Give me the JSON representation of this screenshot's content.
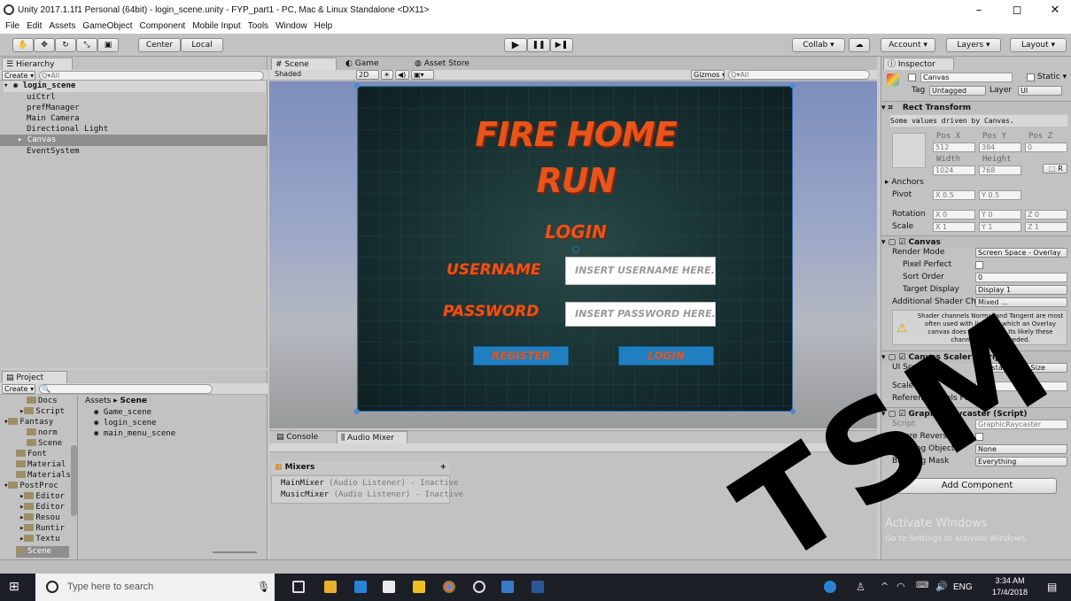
{
  "window": {
    "title": "Unity 2017.1.1f1 Personal (64bit) - login_scene.unity - FYP_part1 - PC, Mac & Linux Standalone <DX11>",
    "minimize": "–",
    "maximize": "◻",
    "close": "✕"
  },
  "menu": [
    "File",
    "Edit",
    "Assets",
    "GameObject",
    "Component",
    "Mobile Input",
    "Tools",
    "Window",
    "Help"
  ],
  "toolbar": {
    "center_label": "Center",
    "local_label": "Local",
    "collab_label": "Collab ▾",
    "account_label": "Account ▾",
    "layers_label": "Layers ▾",
    "layout_label": "Layout ▾",
    "play": "▶",
    "pause": "❚❚",
    "step": "▶❚"
  },
  "hierarchy": {
    "tab": "Hierarchy",
    "create": "Create ▾",
    "search": "Q▾All",
    "scene": "login_scene",
    "items": [
      "uiCtrl",
      "prefManager",
      "Main Camera",
      "Directional Light",
      "Canvas",
      "EventSystem"
    ]
  },
  "scene_view": {
    "tabs": [
      "Scene",
      "Game",
      "Asset Store"
    ],
    "shading": "Shaded",
    "mode_2d": "2D",
    "gizmos": "Gizmos ▾",
    "search": "Q▾All"
  },
  "game_ui": {
    "title_line1": "FIRE HOME",
    "title_line2": "RUN",
    "login_heading": "LOGIN",
    "username_label": "USERNAME",
    "password_label": "PASSWORD",
    "username_placeholder": "INSERT USERNAME HERE...",
    "password_placeholder": "INSERT PASSWORD HERE...",
    "register_button": "REGISTER",
    "login_button": "LOGIN"
  },
  "project": {
    "tab": "Project",
    "create": "Create ▾",
    "breadcrumb_root": "Assets",
    "breadcrumb_leaf": "Scene",
    "folders": [
      "Docs",
      "Script",
      "Fantasy",
      "norm",
      "Scene",
      "Font",
      "Material",
      "Materials",
      "PostProc",
      "Editor",
      "Editor",
      "Resou",
      "Runtir",
      "Textu",
      "Scene"
    ],
    "files": [
      "Game_scene",
      "login_scene",
      "main_menu_scene"
    ]
  },
  "console": {
    "tabs": [
      "Console",
      "Audio Mixer"
    ],
    "mixers_header": "Mixers",
    "mixers": [
      {
        "name": "MainMixer",
        "status": "(Audio Listener) - Inactive"
      },
      {
        "name": "MusicMixer",
        "status": "(Audio Listener) - Inactive"
      }
    ]
  },
  "inspector": {
    "tab": "Inspector",
    "object_name": "Canvas",
    "static_label": "Static ▾",
    "tag_label": "Tag",
    "tag_value": "Untagged",
    "layer_label": "Layer",
    "layer_value": "UI",
    "rect_transform": {
      "title": "Rect Transform",
      "note": "Some values driven by Canvas.",
      "pos_x_label": "Pos X",
      "pos_y_label": "Pos Y",
      "pos_z_label": "Pos Z",
      "pos_x": "512",
      "pos_y": "384",
      "pos_z": "0",
      "width_label": "Width",
      "height_label": "Height",
      "width": "1024",
      "height": "768",
      "anchors": "Anchors",
      "pivot_label": "Pivot",
      "pivot_x": "X 0.5",
      "pivot_y": "Y 0.5",
      "rotation_label": "Rotation",
      "rot_x": "X 0",
      "rot_y": "Y 0",
      "rot_z": "Z 0",
      "scale_label": "Scale",
      "scale_x": "X 1",
      "scale_y": "Y 1",
      "scale_z": "Z 1"
    },
    "canvas": {
      "title": "Canvas",
      "render_mode_label": "Render Mode",
      "render_mode": "Screen Space - Overlay",
      "pixel_perfect_label": "Pixel Perfect",
      "sort_order_label": "Sort Order",
      "sort_order": "0",
      "target_display_label": "Target Display",
      "target_display": "Display 1",
      "shader_label": "Additional Shader Ch",
      "shader_value": "Mixed ...",
      "warning": "Shader channels Normal and Tangent are most often used with lighting, which an Overlay canvas does not support. Its likely these channels are not needed."
    },
    "canvas_scaler": {
      "title": "Canvas Scaler (Script)",
      "ui_scale_mode_label": "UI Scale Mode",
      "ui_scale_mode": "Constant Pixel Size",
      "scale_factor_label": "Scale Factor",
      "scale_factor": "1",
      "ref_ppu_label": "Reference Pixels Per",
      "ref_ppu": "100"
    },
    "graphic_raycaster": {
      "title": "Graphic Raycaster (Script)",
      "script_label": "Script",
      "script_value": "GraphicRaycaster",
      "ignore_reversed_label": "Ignore Reversed Gr",
      "blocking_objects_label": "Blocking Objects",
      "blocking_objects": "None",
      "blocking_mask_label": "Blocking Mask",
      "blocking_mask": "Everything"
    },
    "add_component": "Add Component",
    "activate_title": "Activate Windows",
    "activate_sub": "Go to Settings to activate Windows."
  },
  "taskbar": {
    "search_placeholder": "Type here to search",
    "language": "ENG",
    "time": "3:34 AM",
    "date": "17/4/2018"
  },
  "watermark": "TSM",
  "colors": {
    "accent_orange": "#e8541a",
    "button_blue": "#1f7fc0",
    "canvas_teal": "#1e3a3c",
    "selection": "#8e8e8e"
  }
}
